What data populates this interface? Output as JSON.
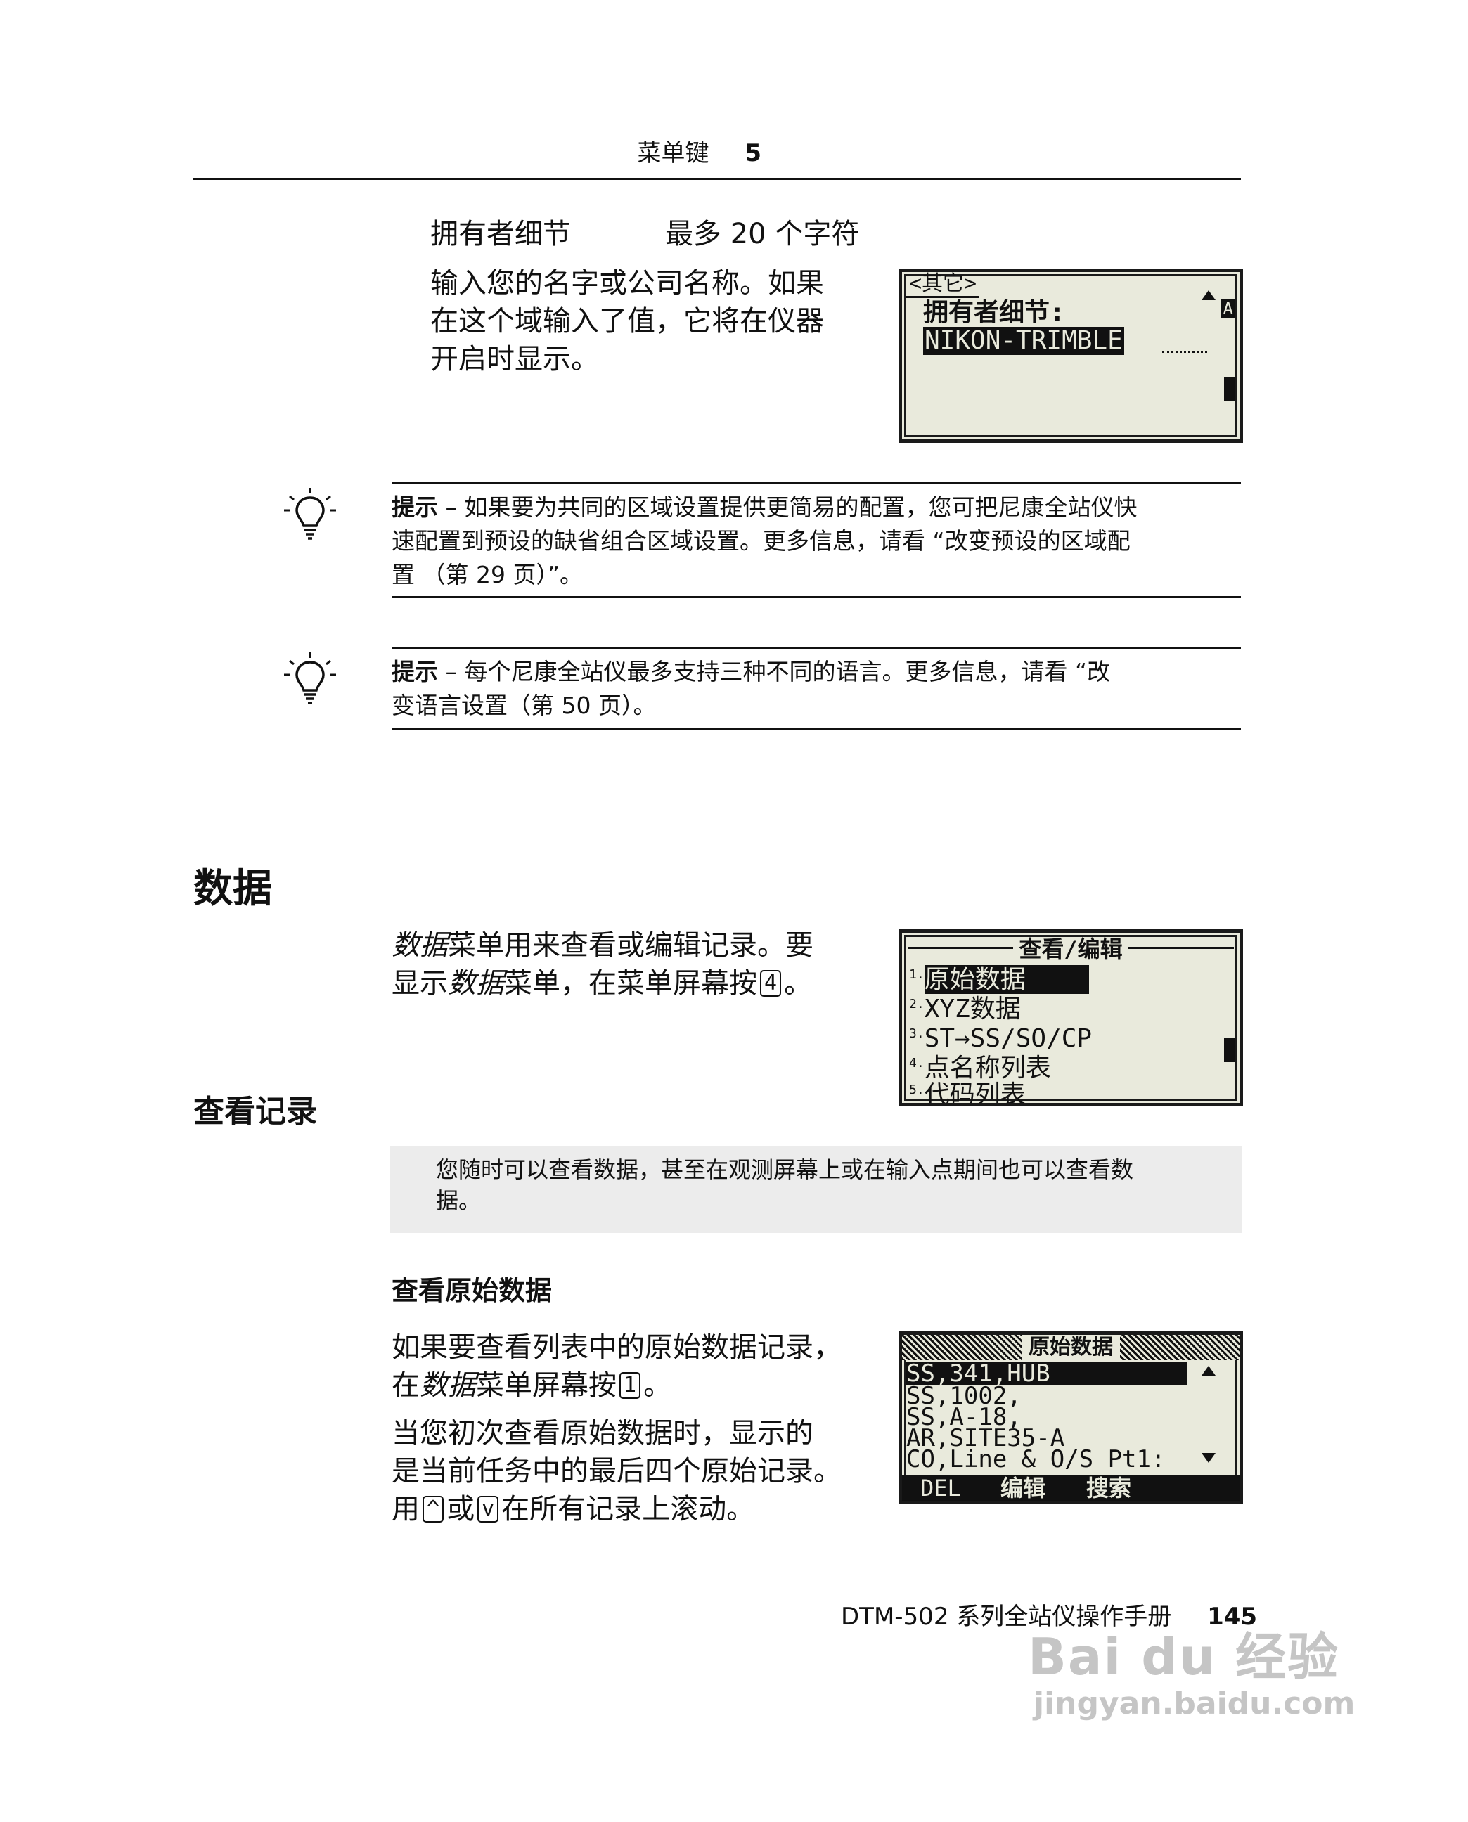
{
  "header": {
    "chapter_title": "菜单键",
    "chapter_number": "5"
  },
  "owner_section": {
    "field_label": "拥有者细节",
    "field_limit": "最多 20 个字符",
    "description_lines": [
      "输入您的名字或公司名称。如果",
      "在这个域输入了值，它将在仪器",
      "开启时显示。"
    ]
  },
  "screen_owner": {
    "tab": "<其它>",
    "label": "拥有者细节:",
    "value": "NIKON-TRIMBLE",
    "indicator_a": "A"
  },
  "tips": [
    {
      "label": "提示",
      "lines": [
        "– 如果要为共同的区域设置提供更简易的配置，您可把尼康全站仪快",
        "速配置到预设的缺省组合区域设置。更多信息，请看 “改变预设的区域配",
        "置 （第 29 页）”。"
      ]
    },
    {
      "label": "提示",
      "lines": [
        "– 每个尼康全站仪最多支持三种不同的语言。更多信息，请看 “改",
        "变语言设置（第 50 页）。"
      ]
    }
  ],
  "data_section": {
    "heading": "数据",
    "intro_line1_em": "数据",
    "intro_line1_rest": "菜单用来查看或编辑记录。要",
    "intro_line2_pre": "显示",
    "intro_line2_em": "数据",
    "intro_line2_mid": "菜单，在菜单屏幕按",
    "intro_line2_key": "4",
    "intro_line2_end": "。"
  },
  "screen_menu": {
    "title": "查看/编辑",
    "items": [
      {
        "num": "1.",
        "label": "原始数据"
      },
      {
        "num": "2.",
        "label": "XYZ数据"
      },
      {
        "num": "3.",
        "label": "ST→SS/SO/CP"
      },
      {
        "num": "4.",
        "label": "点名称列表"
      },
      {
        "num": "5.",
        "label": "代码列表"
      }
    ]
  },
  "view_records": {
    "heading": "查看记录",
    "note_lines": [
      "您随时可以查看数据，甚至在观测屏幕上或在输入点期间也可以查看数",
      "据。"
    ]
  },
  "raw_data": {
    "subheading": "查看原始数据",
    "p1_line1": "如果要查看列表中的原始数据记录，",
    "p1_line2_pre": "在",
    "p1_line2_em": "数据",
    "p1_line2_mid": "菜单屏幕按",
    "p1_line2_key": "1",
    "p1_line2_end": "。",
    "p2_line1": "当您初次查看原始数据时，显示的",
    "p2_line2": "是当前任务中的最后四个原始记录。",
    "p2_line3_pre": "用",
    "p2_key_up": "^",
    "p2_line3_mid": "或",
    "p2_key_down": "v",
    "p2_line3_end": "在所有记录上滚动。"
  },
  "screen_raw": {
    "title": "原始数据",
    "rows": [
      "SS,341,HUB",
      "SS,1002,",
      "SS,A-18,",
      "AR,SITE35-A",
      "CO,Line & O/S Pt1:"
    ],
    "softkeys": [
      "DEL",
      "编辑",
      "搜索"
    ]
  },
  "footer": {
    "manual_title": "DTM-502 系列全站仪操作手册",
    "page_number": "145"
  },
  "watermark": {
    "brand": "Bai du 经验",
    "url": "jingyan.baidu.com"
  }
}
